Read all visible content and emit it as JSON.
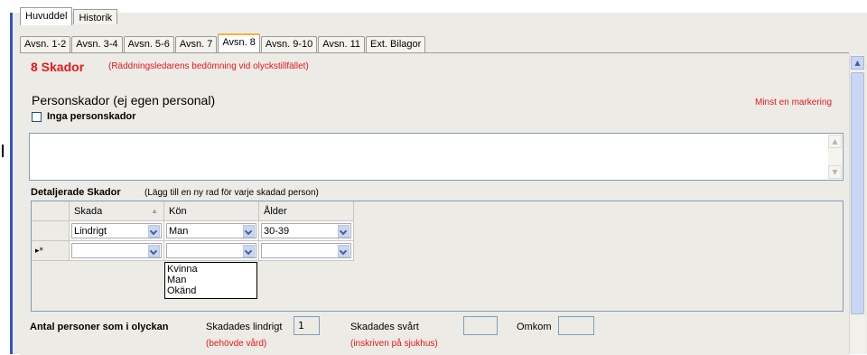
{
  "outer_tabs": [
    "Huvuddel",
    "Historik"
  ],
  "inner_tabs": [
    "Avsn. 1-2",
    "Avsn. 3-4",
    "Avsn. 5-6",
    "Avsn. 7",
    "Avsn. 8",
    "Avsn. 9-10",
    "Avsn. 11",
    "Ext. Bilagor"
  ],
  "section": {
    "title": "8 Skador",
    "subtitle": "(Räddningsledarens bedömning vid olyckstillfället)",
    "heading": "Personskador (ej egen personal)",
    "required_note": "Minst en markering",
    "checkbox_label": "Inga personskador"
  },
  "details": {
    "heading": "Detaljerade Skador",
    "note": "(Lägg till en ny rad för varje skadad person)",
    "columns": [
      "Skada",
      "Kön",
      "Ålder"
    ],
    "rows": [
      {
        "marker": "",
        "skada": "Lindrigt",
        "kon": "Man",
        "alder": "30-39"
      },
      {
        "marker": "▸*",
        "skada": "",
        "kon": "",
        "alder": ""
      }
    ],
    "dropdown_options": [
      "Kvinna",
      "Man",
      "Okänd"
    ]
  },
  "counts": {
    "label": "Antal personer som i olyckan",
    "lindrigt_label": "Skadades lindrigt",
    "lindrigt_value": "1",
    "lindrigt_note": "(behövde vård)",
    "svart_label": "Skadades svårt",
    "svart_value": "",
    "svart_note": "(inskriven på sjukhus)",
    "omkom_label": "Omkom",
    "omkom_value": ""
  },
  "colors": {
    "accent_red": "#e8181a",
    "tab_highlight": "#f8b23a",
    "blue_bar": "#2a56c6"
  }
}
